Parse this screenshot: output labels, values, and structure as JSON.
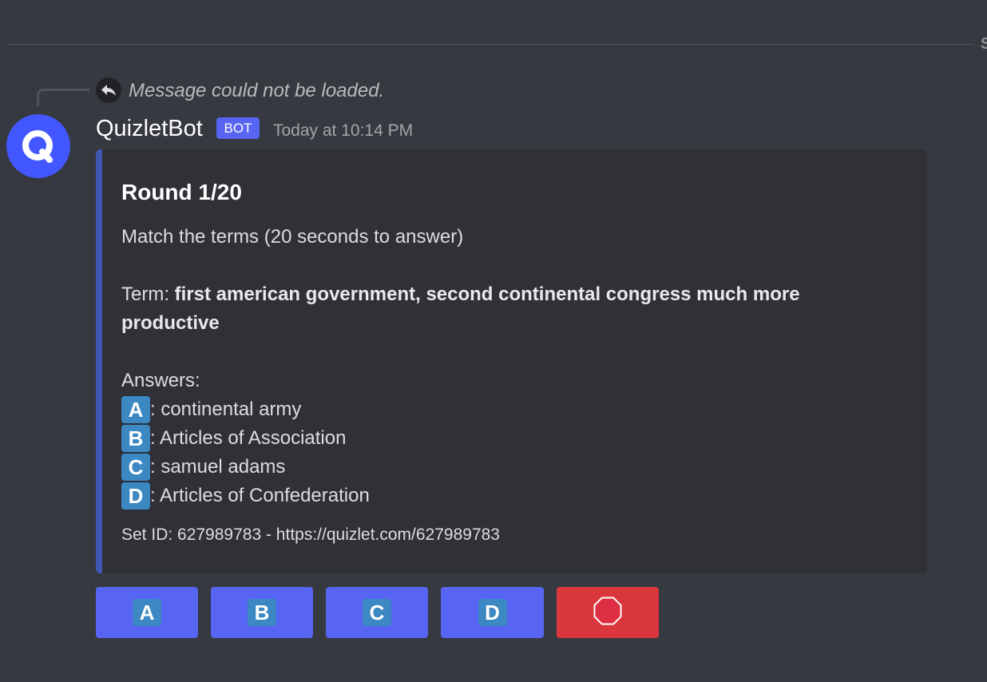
{
  "reply": {
    "text": "Message could not be loaded."
  },
  "author": {
    "username": "QuizletBot",
    "tag": "BOT",
    "timestamp": "Today at 10:14 PM",
    "avatar_color": "#4257ff"
  },
  "embed": {
    "accent_color": "#4257b2",
    "title": "Round 1/20",
    "instructions": "Match the terms (20 seconds to answer)",
    "term_label": "Term: ",
    "term_line1": "first american government, second continental congress much more",
    "term_line2": "productive",
    "answers_label": "Answers:",
    "answers": [
      {
        "letter": "A",
        "text": ": continental army"
      },
      {
        "letter": "B",
        "text": ": Articles of Association"
      },
      {
        "letter": "C",
        "text": ": samuel adams"
      },
      {
        "letter": "D",
        "text": ": Articles of Confederation"
      }
    ],
    "footer": "Set ID: 627989783 - https://quizlet.com/627989783"
  },
  "buttons": [
    {
      "letter": "A",
      "color": "#5865f2"
    },
    {
      "letter": "B",
      "color": "#5865f2"
    },
    {
      "letter": "C",
      "color": "#5865f2"
    },
    {
      "letter": "D",
      "color": "#5865f2"
    },
    {
      "icon": "stop-sign-icon",
      "color": "#da373c"
    }
  ],
  "colors": {
    "background": "#36393f",
    "embed_background": "#2f3136",
    "letter_badge": "#3b88c3"
  }
}
